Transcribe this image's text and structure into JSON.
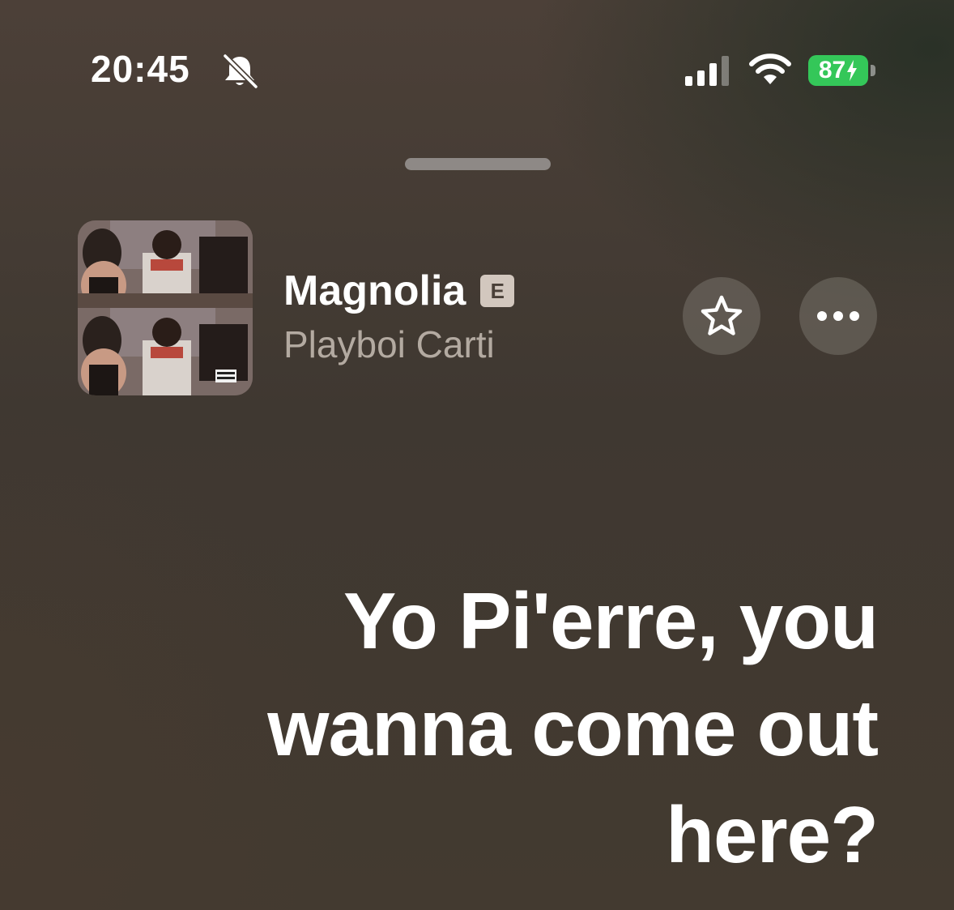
{
  "status_bar": {
    "time": "20:45",
    "battery_level": "87",
    "battery_color": "#34c759",
    "icons": [
      "bell-slash-icon",
      "signal-icon",
      "wifi-icon",
      "battery-charging-icon"
    ]
  },
  "now_playing": {
    "title": "Magnolia",
    "explicit_label": "E",
    "artist": "Playboi Carti",
    "artwork_icon": "album-artwork",
    "actions": {
      "favorite_icon": "star-icon",
      "more_icon": "ellipsis-icon"
    }
  },
  "lyrics": {
    "current_line": "Yo Pi'erre, you wanna come out here?"
  }
}
